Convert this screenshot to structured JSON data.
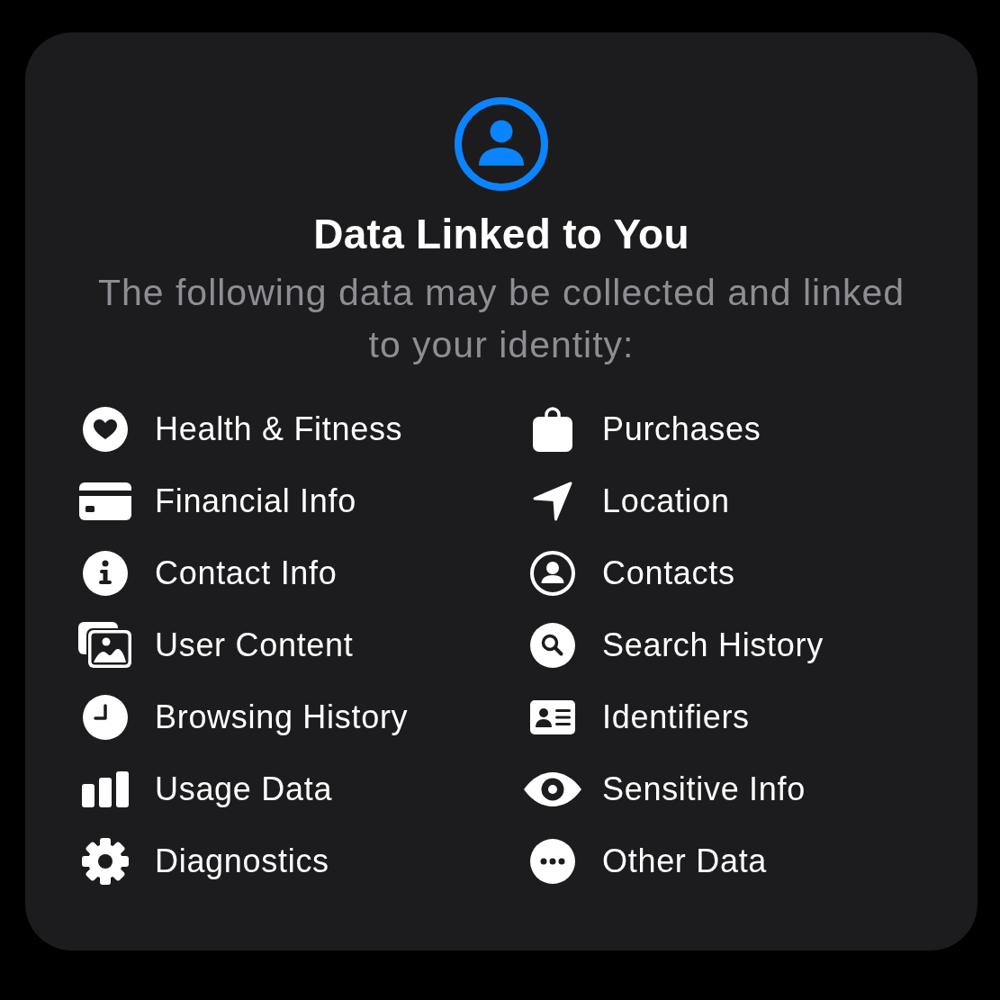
{
  "header": {
    "title": "Data Linked to You",
    "subtitle": "The following data may be collected and linked to your identity:"
  },
  "items": [
    {
      "label": "Health & Fitness"
    },
    {
      "label": "Purchases"
    },
    {
      "label": "Financial Info"
    },
    {
      "label": "Location"
    },
    {
      "label": "Contact Info"
    },
    {
      "label": "Contacts"
    },
    {
      "label": "User Content"
    },
    {
      "label": "Search History"
    },
    {
      "label": "Browsing History"
    },
    {
      "label": "Identifiers"
    },
    {
      "label": "Usage Data"
    },
    {
      "label": "Sensitive Info"
    },
    {
      "label": "Diagnostics"
    },
    {
      "label": "Other Data"
    }
  ]
}
